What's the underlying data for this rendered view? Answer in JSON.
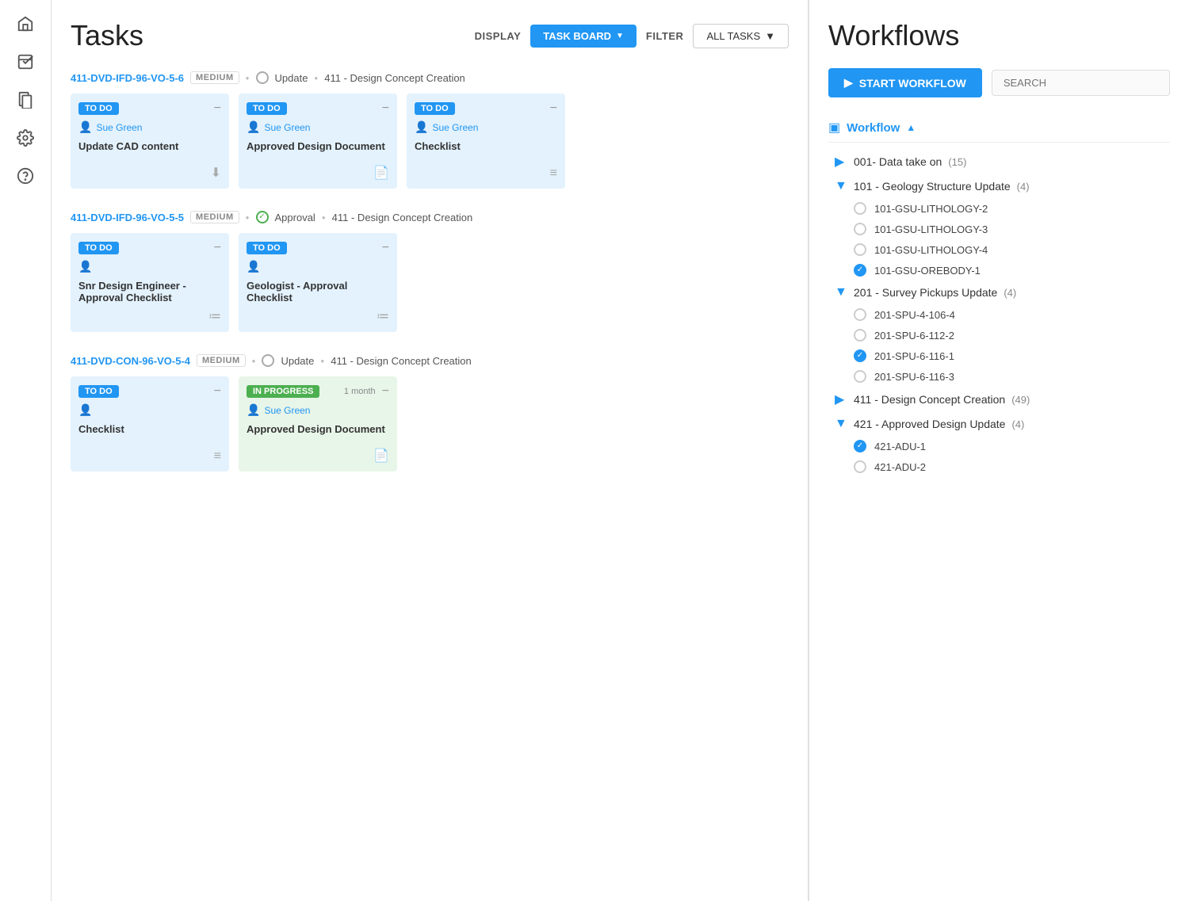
{
  "sidebar": {
    "icons": [
      {
        "name": "home-icon",
        "symbol": "⌂"
      },
      {
        "name": "tasks-icon",
        "symbol": "☑"
      },
      {
        "name": "documents-icon",
        "symbol": "❒"
      },
      {
        "name": "settings-icon",
        "symbol": "⚙"
      },
      {
        "name": "help-icon",
        "symbol": "?"
      }
    ]
  },
  "tasks": {
    "title": "Tasks",
    "display_label": "DISPLAY",
    "task_board_label": "TASK BOARD",
    "filter_label": "FILTER",
    "all_tasks_label": "ALL TASKS",
    "groups": [
      {
        "id": "411-DVD-IFD-96-VO-5-6",
        "badge": "MEDIUM",
        "type_icon": "circle",
        "type": "Update",
        "name": "411 - Design Concept Creation",
        "cards": [
          {
            "status": "TO DO",
            "status_type": "todo",
            "user": "Sue Green",
            "title": "Update CAD content",
            "icon_type": "download",
            "time": ""
          },
          {
            "status": "TO DO",
            "status_type": "todo",
            "user": "Sue Green",
            "title": "Approved Design Document",
            "icon_type": "file",
            "time": ""
          },
          {
            "status": "TO DO",
            "status_type": "todo",
            "user": "Sue Green",
            "title": "Checklist",
            "icon_type": "list",
            "time": ""
          }
        ]
      },
      {
        "id": "411-DVD-IFD-96-VO-5-5",
        "badge": "MEDIUM",
        "type_icon": "check-circle",
        "type": "Approval",
        "name": "411 - Design Concept Creation",
        "cards": [
          {
            "status": "TO DO",
            "status_type": "todo",
            "user": "",
            "title": "Snr Design Engineer - Approval Checklist",
            "icon_type": "checklist",
            "time": ""
          },
          {
            "status": "TO DO",
            "status_type": "todo",
            "user": "",
            "title": "Geologist - Approval Checklist",
            "icon_type": "checklist",
            "time": ""
          }
        ]
      },
      {
        "id": "411-DVD-CON-96-VO-5-4",
        "badge": "MEDIUM",
        "type_icon": "circle",
        "type": "Update",
        "name": "411 - Design Concept Creation",
        "cards": [
          {
            "status": "TO DO",
            "status_type": "todo",
            "user": "",
            "title": "Checklist",
            "icon_type": "list",
            "time": ""
          },
          {
            "status": "IN PROGRESS",
            "status_type": "inprogress",
            "user": "Sue Green",
            "title": "Approved Design Document",
            "icon_type": "file",
            "time": "1 month"
          }
        ]
      }
    ]
  },
  "workflows": {
    "title": "Workflows",
    "start_btn": "START WORKFLOW",
    "search_placeholder": "SEARCH",
    "section_label": "Workflow",
    "items": [
      {
        "id": "001",
        "label": "001- Data take on",
        "count": 15,
        "expanded": false,
        "children": []
      },
      {
        "id": "101",
        "label": "101 - Geology Structure Update",
        "count": 4,
        "expanded": true,
        "children": [
          {
            "label": "101-GSU-LITHOLOGY-2",
            "checked": false
          },
          {
            "label": "101-GSU-LITHOLOGY-3",
            "checked": false
          },
          {
            "label": "101-GSU-LITHOLOGY-4",
            "checked": false
          },
          {
            "label": "101-GSU-OREBODY-1",
            "checked": true
          }
        ]
      },
      {
        "id": "201",
        "label": "201 - Survey Pickups Update",
        "count": 4,
        "expanded": true,
        "children": [
          {
            "label": "201-SPU-4-106-4",
            "checked": false
          },
          {
            "label": "201-SPU-6-112-2",
            "checked": false
          },
          {
            "label": "201-SPU-6-116-1",
            "checked": true
          },
          {
            "label": "201-SPU-6-116-3",
            "checked": false
          }
        ]
      },
      {
        "id": "411",
        "label": "411 - Design Concept Creation",
        "count": 49,
        "expanded": false,
        "children": []
      },
      {
        "id": "421",
        "label": "421 - Approved Design Update",
        "count": 4,
        "expanded": true,
        "children": [
          {
            "label": "421-ADU-1",
            "checked": true
          },
          {
            "label": "421-ADU-2",
            "checked": false
          }
        ]
      }
    ]
  }
}
